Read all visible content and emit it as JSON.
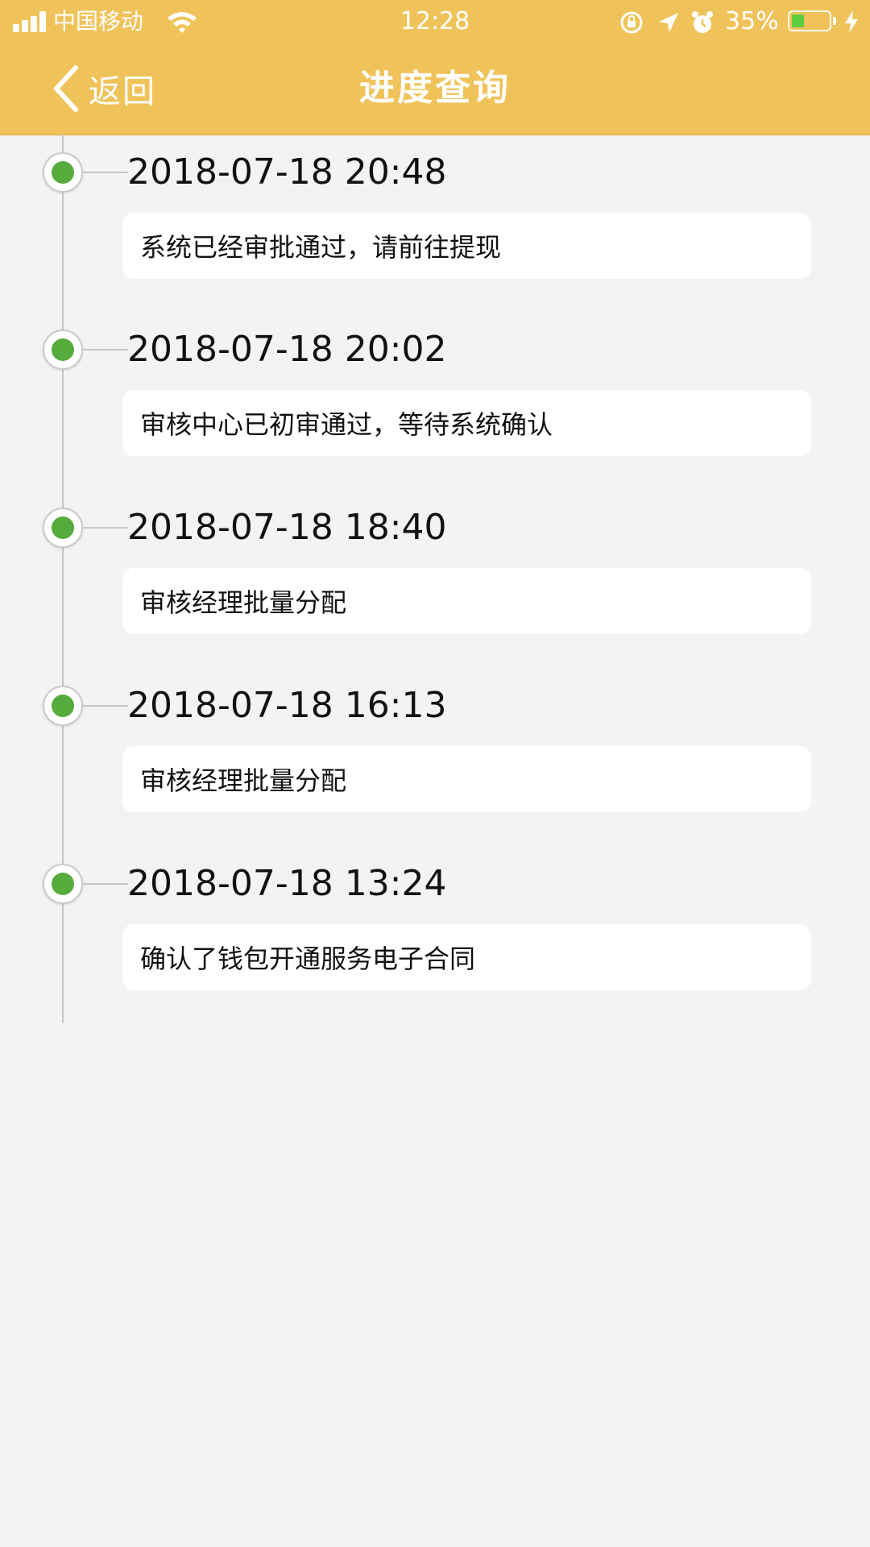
{
  "status_bar": {
    "carrier": "中国移动",
    "time": "12:28",
    "battery_percent": "35%",
    "battery_level": 0.35,
    "icons": [
      "signal-icon",
      "wifi-icon",
      "rotation-lock-icon",
      "location-arrow-icon",
      "alarm-clock-icon",
      "battery-icon",
      "charging-bolt-icon"
    ]
  },
  "nav": {
    "back_label": "返回",
    "title": "进度查询"
  },
  "colors": {
    "header_background": "#f0c35a",
    "page_background": "#f3f4f2",
    "node_green": "#56ab3d",
    "battery_green": "#5ccd3f"
  },
  "timeline": [
    {
      "time": "2018-07-18 20:48",
      "description": "系统已经审批通过，请前往提现"
    },
    {
      "time": "2018-07-18 20:02",
      "description": "审核中心已初审通过，等待系统确认"
    },
    {
      "time": "2018-07-18 18:40",
      "description": "审核经理批量分配"
    },
    {
      "time": "2018-07-18 16:13",
      "description": "审核经理批量分配"
    },
    {
      "time": "2018-07-18 13:24",
      "description": "确认了钱包开通服务电子合同"
    }
  ]
}
